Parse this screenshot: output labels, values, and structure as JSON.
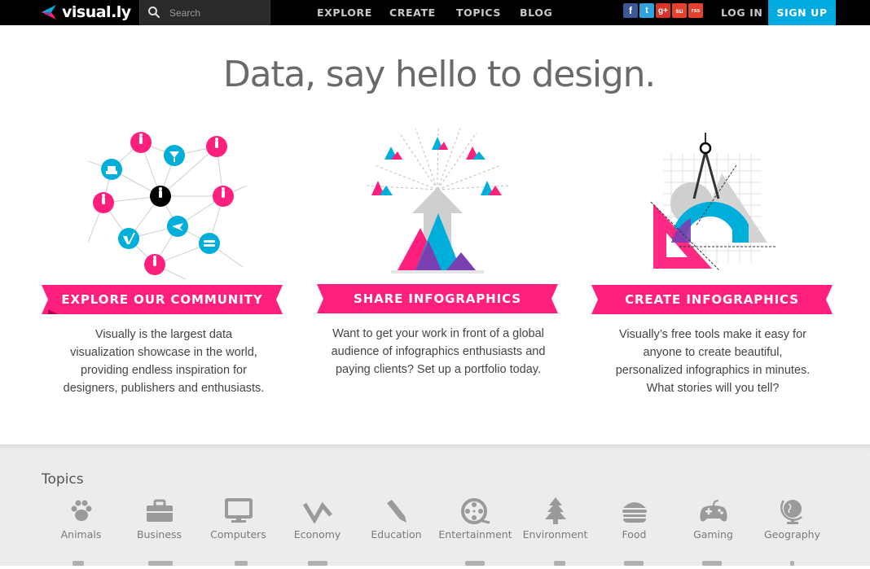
{
  "nav": {
    "logo": "visual.ly",
    "search_placeholder": "Search",
    "links": [
      "EXPLORE",
      "CREATE",
      "TOPICS",
      "BLOG"
    ],
    "social": [
      {
        "name": "facebook",
        "glyph": "f",
        "color": "#3b5998"
      },
      {
        "name": "twitter",
        "glyph": "t",
        "color": "#2fa3e0"
      },
      {
        "name": "google-plus",
        "glyph": "g+",
        "color": "#d8352a"
      },
      {
        "name": "stumbleupon",
        "glyph": "su",
        "color": "#e5422c"
      },
      {
        "name": "rss",
        "glyph": "rss",
        "color": "#e5422c"
      }
    ],
    "login": "LOG IN",
    "signup": "SIGN UP"
  },
  "hero": {
    "headline": "Data, say hello to design."
  },
  "features": [
    {
      "title": "EXPLORE OUR COMMUNITY",
      "description": [
        "Visually is the largest data",
        "visualization showcase in the world,",
        "providing endless inspiration for",
        "designers, publishers and enthusiasts."
      ]
    },
    {
      "title": "SHARE INFOGRAPHICS",
      "description": [
        "Want to get your work in front of a global",
        "audience of infographics enthusiasts and",
        "paying clients? Set up a portfolio today."
      ]
    },
    {
      "title": "CREATE INFOGRAPHICS",
      "description": [
        "Visually’s free tools make it easy for",
        "anyone to create beautiful,",
        "personalized infographics in minutes.",
        "What stories will you tell?"
      ]
    }
  ],
  "topics": {
    "title": "Topics",
    "items": [
      {
        "label": "Animals",
        "icon": "paw-icon"
      },
      {
        "label": "Business",
        "icon": "briefcase-icon"
      },
      {
        "label": "Computers",
        "icon": "monitor-icon"
      },
      {
        "label": "Economy",
        "icon": "trend-icon"
      },
      {
        "label": "Education",
        "icon": "pencil-icon"
      },
      {
        "label": "Entertainment",
        "icon": "film-reel-icon"
      },
      {
        "label": "Environment",
        "icon": "tree-icon"
      },
      {
        "label": "Food",
        "icon": "burger-icon"
      },
      {
        "label": "Gaming",
        "icon": "gamepad-icon"
      },
      {
        "label": "Geography",
        "icon": "globe-icon"
      }
    ]
  },
  "colors": {
    "pink": "#ff1f7c",
    "cyan": "#00aeda",
    "signup": "#00a9df",
    "black": "#000000"
  }
}
